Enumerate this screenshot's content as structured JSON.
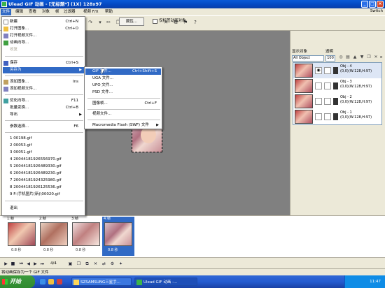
{
  "window": {
    "title": "Ulead GIF 动画 - [无标题*] (1X) 128x97"
  },
  "menubar": {
    "items": [
      "文件",
      "编辑",
      "查看",
      "对象",
      "帧",
      "过滤器",
      "视频 F/X",
      "帮助"
    ],
    "switch_label": "Switch"
  },
  "toolbar": {
    "properties_label": "属性...",
    "checkbox_label": "仅标签动画对象"
  },
  "file_menu": {
    "items": [
      {
        "label": "新建",
        "shortcut": "Ctrl+N"
      },
      {
        "label": "打开图象...",
        "shortcut": "Ctrl+O"
      },
      {
        "label": "打开视频文件...",
        "shortcut": ""
      },
      {
        "label": "动画向导...",
        "shortcut": ""
      },
      {
        "label": "收复",
        "shortcut": ""
      },
      {
        "label": "保存",
        "shortcut": "Ctrl+S"
      },
      {
        "label": "另存为",
        "shortcut": ""
      },
      {
        "label": "添加图象...",
        "shortcut": "Ins"
      },
      {
        "label": "添加视频文件...",
        "shortcut": ""
      },
      {
        "label": "优化向导...",
        "shortcut": "F11"
      },
      {
        "label": "批量变换...",
        "shortcut": "Ctrl+B"
      },
      {
        "label": "导出",
        "shortcut": ""
      },
      {
        "label": "参数选择...",
        "shortcut": "F6"
      }
    ],
    "recent": [
      "1 00198.gif",
      "2 00053.gif",
      "3 00051.gif",
      "4 20044181926556970.gif",
      "5 20044181926489330.gif",
      "6 20044181926489230.gif",
      "7 20044181924325980.gif",
      "8 20044181926125536.gif",
      "9 F:\\手机图片(新)\\00020.gif"
    ],
    "exit": "退出"
  },
  "saveas_submenu": {
    "items": [
      {
        "label": "GIF 文件...",
        "shortcut": "Ctrl+Shift+S"
      },
      {
        "label": "UGA 文件...",
        "shortcut": ""
      },
      {
        "label": "UFO 文件...",
        "shortcut": ""
      },
      {
        "label": "PSD 文件...",
        "shortcut": ""
      },
      {
        "label": "图像帧...",
        "shortcut": "Ctrl+F"
      },
      {
        "label": "视频文件...",
        "shortcut": ""
      },
      {
        "label": "Macromedia Flash (SWF) 文件",
        "shortcut": ""
      }
    ]
  },
  "right_panel": {
    "display_label": "显示对象",
    "opacity_label": "透明",
    "select_value": "All Object",
    "opacity_value": "100",
    "layers": [
      {
        "name": "Obj - 4",
        "info": "(0,0)(W:128,H:97)"
      },
      {
        "name": "Obj - 3",
        "info": "(0,0)(W:128,H:97)"
      },
      {
        "name": "Obj - 2",
        "info": "(0,0)(W:128,H:97)"
      },
      {
        "name": "Obj - 1",
        "info": "(0,0)(W:128,H:97)"
      }
    ]
  },
  "frames": [
    {
      "label": "1:帧",
      "delay": "0.8 秒"
    },
    {
      "label": "2:帧",
      "delay": "0.8 秒"
    },
    {
      "label": "3:帧",
      "delay": "0.8 秒"
    },
    {
      "label": "4:帧",
      "delay": "0.8 秒"
    }
  ],
  "playbar": {
    "counter": "4/4"
  },
  "statusbar": {
    "text": "将动画保存为一个 GIF 文件"
  },
  "taskbar": {
    "start_label": "开始",
    "tasks": [
      "SZSAMSUNG三星手...",
      "Ulead GIF 动画 -..."
    ],
    "clock": "11:47"
  },
  "colors": {
    "selection": "#316ac5",
    "title_blue": "#0447c0",
    "taskbar_blue": "#245bd0",
    "start_green": "#2f8a2f"
  }
}
